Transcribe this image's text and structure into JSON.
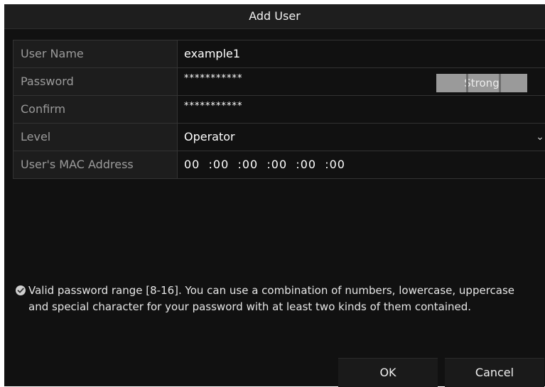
{
  "dialog": {
    "title": "Add User",
    "fields": {
      "user_name": {
        "label": "User Name",
        "value": "example1"
      },
      "password": {
        "label": "Password",
        "value": "***********",
        "strength": "Strong"
      },
      "confirm": {
        "label": "Confirm",
        "value": "***********"
      },
      "level": {
        "label": "Level",
        "value": "Operator"
      },
      "mac": {
        "label": "User's MAC Address",
        "value": "00  :00  :00  :00  :00  :00"
      }
    },
    "hint": "Valid password range [8-16]. You can use a combination of numbers, lowercase, uppercase and special character for your password with at least two kinds of them contained.",
    "buttons": {
      "ok": "OK",
      "cancel": "Cancel"
    },
    "icons": {
      "hint_icon": "check-circle-icon",
      "dropdown_icon": "chevron-down-icon"
    }
  }
}
